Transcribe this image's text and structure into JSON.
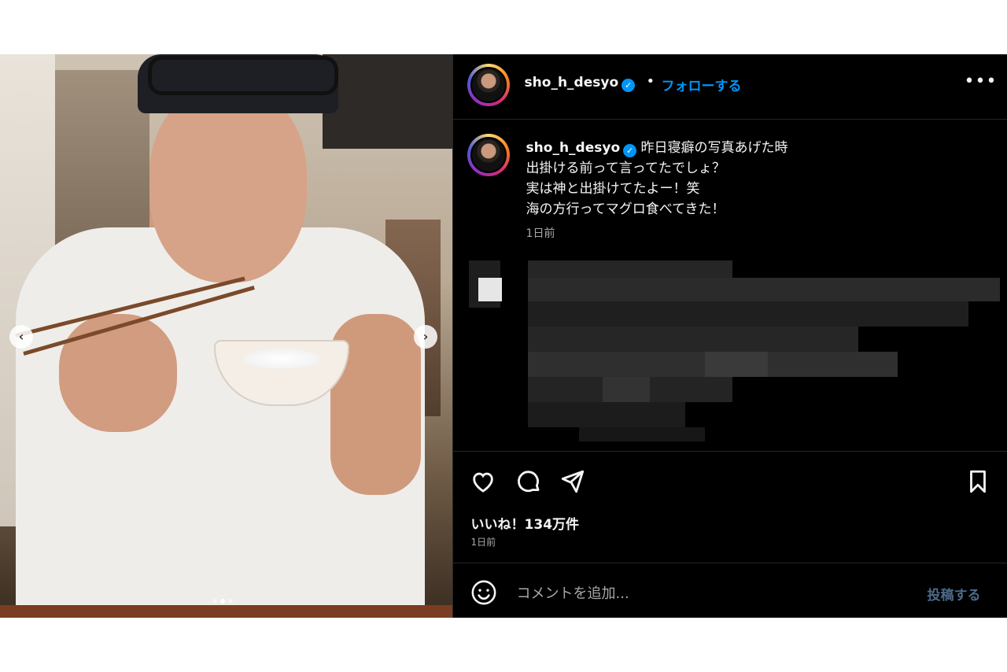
{
  "header": {
    "username": "sho_h_desyo",
    "verified_icon": "verified-badge-icon",
    "separator": "•",
    "follow_label": "フォローする",
    "more_label": "•••"
  },
  "photo": {
    "prev_label": "‹",
    "next_label": "›",
    "carousel_count": 3,
    "carousel_active": 1
  },
  "caption": {
    "username": "sho_h_desyo",
    "lines": [
      "昨日寝癖の写真あげた時",
      "出掛ける前って言ってたでしょ？",
      "実は神と出掛けてたよー！笑",
      "海の方行ってマグロ食べてきた！"
    ],
    "time": "1日前"
  },
  "actions": {
    "likes": "いいね！134万件",
    "time": "1日前"
  },
  "comment": {
    "placeholder": "コメントを追加...",
    "post_label": "投稿する"
  },
  "colors": {
    "accent": "#0095f6",
    "background": "#000000",
    "muted_text": "#a8a8a8",
    "post_disabled": "#4b6a8a"
  }
}
